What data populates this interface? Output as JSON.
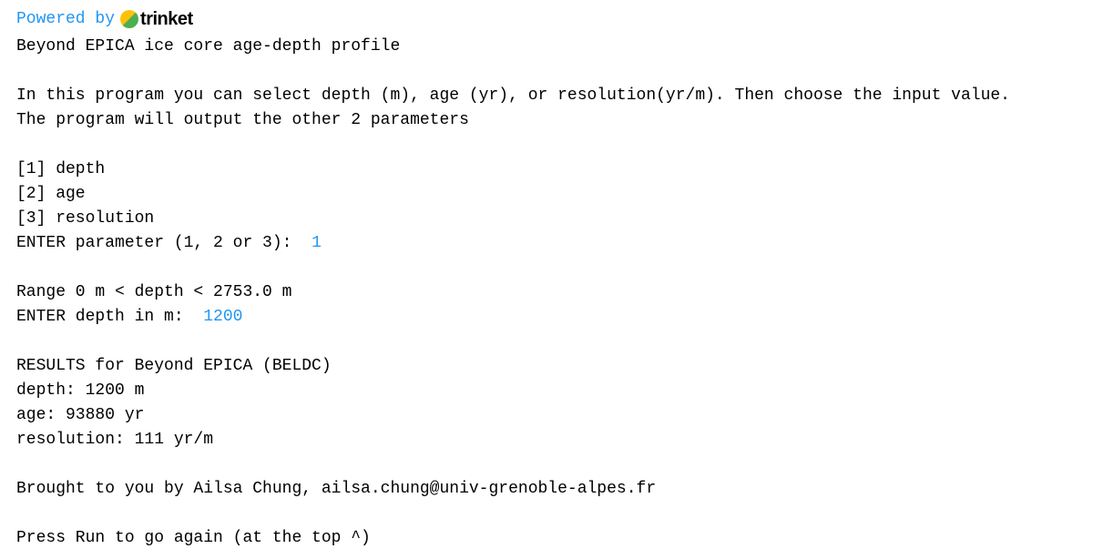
{
  "header": {
    "powered_by": "Powered by",
    "brand": "trinket"
  },
  "console": {
    "title": "Beyond EPICA ice core age-depth profile",
    "intro1": "In this program you can select depth (m), age (yr), or resolution(yr/m). Then choose the input value.",
    "intro2": "The program will output the other 2 parameters",
    "opt1": "[1] depth",
    "opt2": "[2] age",
    "opt3": "[3] resolution",
    "prompt_param": "ENTER parameter (1, 2 or 3):  ",
    "input_param": "1",
    "range": "Range 0 m < depth < 2753.0 m",
    "prompt_depth": "ENTER depth in m:  ",
    "input_depth": "1200",
    "results_header": "RESULTS for Beyond EPICA (BELDC)",
    "result_depth": "depth: 1200 m",
    "result_age": "age: 93880 yr",
    "result_resolution": "resolution: 111 yr/m",
    "credit": "Brought to you by Ailsa Chung, ailsa.chung@univ-grenoble-alpes.fr",
    "again": "Press Run to go again (at the top ^)"
  }
}
